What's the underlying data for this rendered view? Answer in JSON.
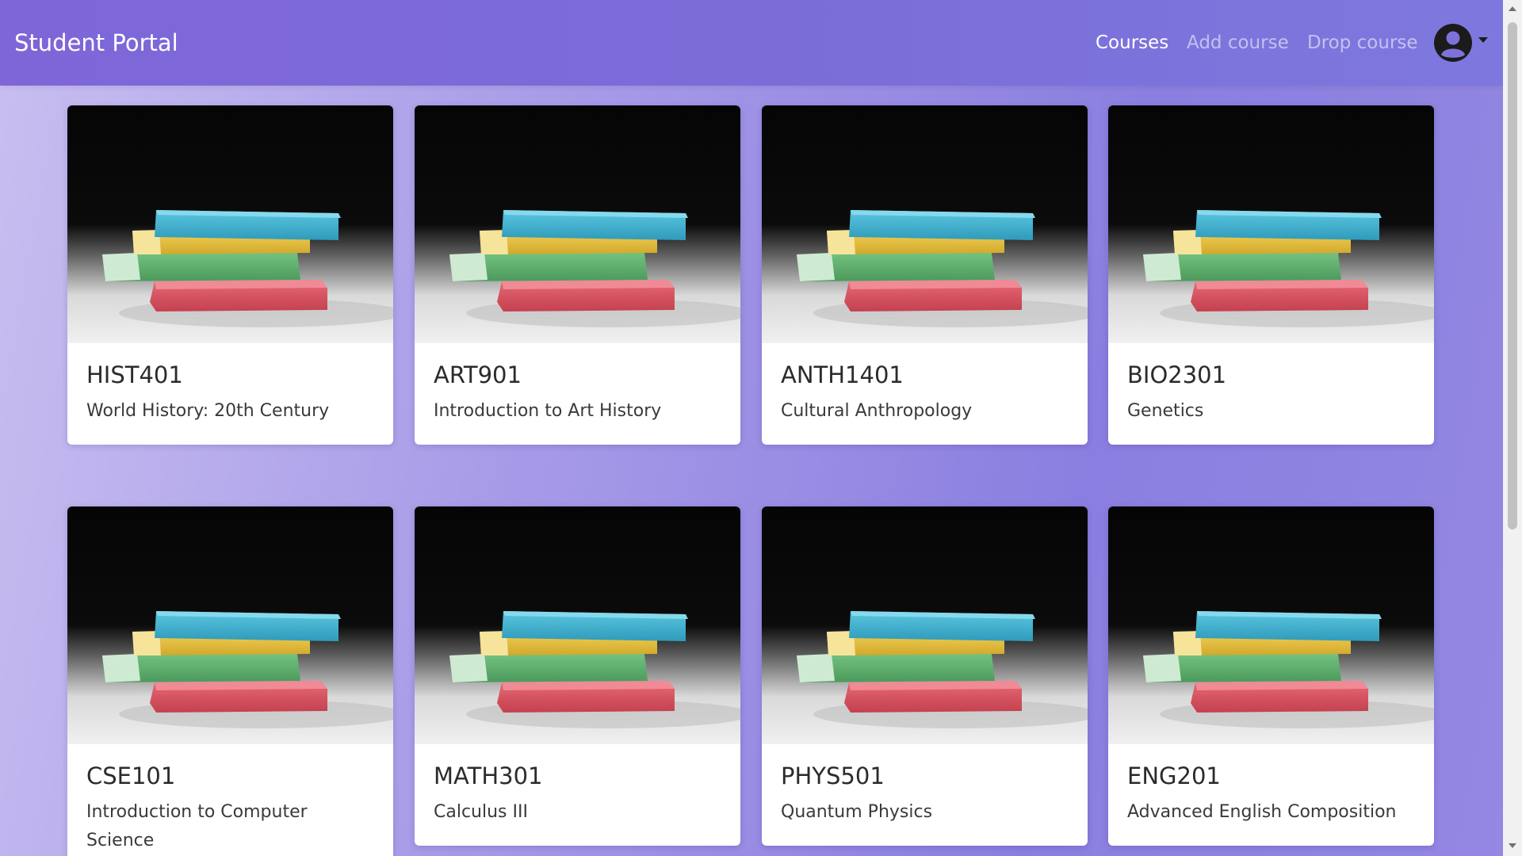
{
  "navbar": {
    "brand": "Student Portal",
    "links": [
      {
        "label": "Courses",
        "active": true
      },
      {
        "label": "Add course",
        "active": false
      },
      {
        "label": "Drop course",
        "active": false
      }
    ],
    "avatar_icon": "user-circle-icon"
  },
  "courses": [
    {
      "code": "HIST401",
      "name": "World History: 20th Century"
    },
    {
      "code": "ART901",
      "name": "Introduction to Art History"
    },
    {
      "code": "ANTH1401",
      "name": "Cultural Anthropology"
    },
    {
      "code": "BIO2301",
      "name": "Genetics"
    },
    {
      "code": "CSE101",
      "name": "Introduction to Computer Science"
    },
    {
      "code": "MATH301",
      "name": "Calculus III"
    },
    {
      "code": "PHYS501",
      "name": "Quantum Physics"
    },
    {
      "code": "ENG201",
      "name": "Advanced English Composition"
    }
  ],
  "colors": {
    "navbar": "#7b6cd8",
    "book_blue": "#3fb1cf",
    "book_yellow": "#e6c23c",
    "book_green": "#5fae6e",
    "book_red": "#d95563"
  }
}
